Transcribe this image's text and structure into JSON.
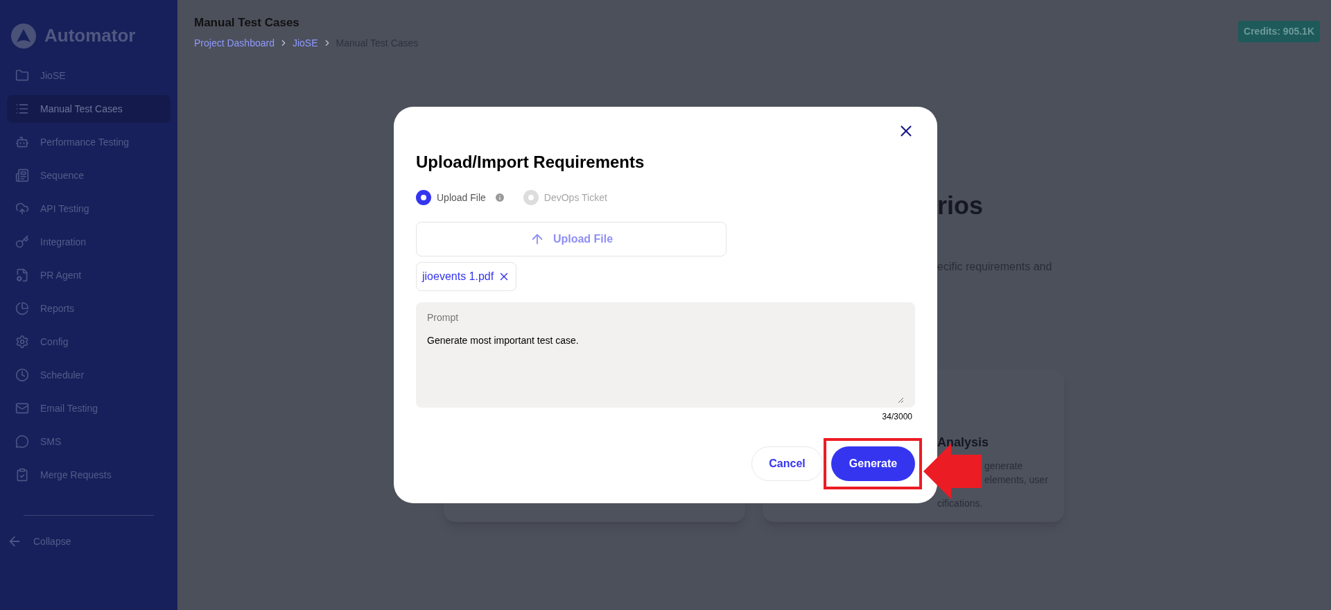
{
  "sidebar": {
    "brand": "Automator",
    "items": [
      {
        "label": "JioSE",
        "selected": false
      },
      {
        "label": "Manual Test Cases",
        "selected": true
      },
      {
        "label": "Performance Testing",
        "selected": false
      },
      {
        "label": "Sequence",
        "selected": false
      },
      {
        "label": "API Testing",
        "selected": false
      },
      {
        "label": "Integration",
        "selected": false
      },
      {
        "label": "PR Agent",
        "selected": false
      },
      {
        "label": "Reports",
        "selected": false
      },
      {
        "label": "Config",
        "selected": false
      },
      {
        "label": "Scheduler",
        "selected": false
      },
      {
        "label": "Email Testing",
        "selected": false
      },
      {
        "label": "SMS",
        "selected": false
      },
      {
        "label": "Merge Requests",
        "selected": false
      }
    ],
    "collapse": "Collapse"
  },
  "header": {
    "title": "Manual Test Cases",
    "breadcrumb": [
      "Project Dashboard",
      "JioSE",
      "Manual Test Cases"
    ],
    "credits": "Credits: 905.1K"
  },
  "background": {
    "heading": "rios",
    "subtitle": "ecific requirements and",
    "card": {
      "title": "Analysis",
      "lines": [
        "generate",
        "elements, user",
        "cifications."
      ]
    }
  },
  "modal": {
    "title": "Upload/Import Requirements",
    "options": [
      {
        "label": "Upload File",
        "selected": true,
        "disabled": false,
        "info": true
      },
      {
        "label": "DevOps Ticket",
        "selected": false,
        "disabled": true,
        "info": false
      }
    ],
    "upload_button": "Upload File",
    "file": "jioevents 1.pdf",
    "prompt": {
      "label": "Prompt",
      "value": "Generate most important test case.",
      "counter": "34/3000"
    },
    "buttons": [
      {
        "label": "Cancel",
        "kind": "secondary"
      },
      {
        "label": "Generate",
        "kind": "primary"
      }
    ]
  }
}
